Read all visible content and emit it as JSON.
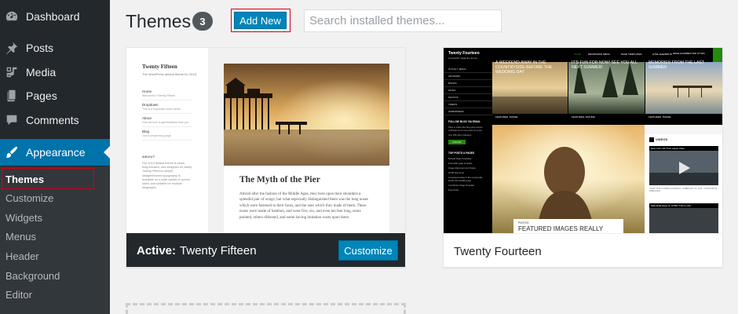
{
  "sidebar": {
    "items": [
      {
        "label": "Dashboard",
        "icon": "dashboard-icon"
      },
      {
        "label": "Posts",
        "icon": "pin-icon"
      },
      {
        "label": "Media",
        "icon": "media-icon"
      },
      {
        "label": "Pages",
        "icon": "pages-icon"
      },
      {
        "label": "Comments",
        "icon": "comment-icon"
      },
      {
        "label": "Appearance",
        "icon": "paintbrush-icon",
        "active": true
      }
    ],
    "submenu": [
      "Themes",
      "Customize",
      "Widgets",
      "Menus",
      "Header",
      "Background",
      "Editor"
    ],
    "current_submenu": "Themes"
  },
  "header": {
    "title": "Themes",
    "count": "3",
    "add_new_label": "Add New",
    "search_placeholder": "Search installed themes..."
  },
  "themes": [
    {
      "name": "Twenty Fifteen",
      "active": true,
      "active_label": "Active:",
      "customize_label": "Customize",
      "preview": {
        "site_title": "Twenty Fifteen",
        "site_desc": "The WordPress default theme for 2015.",
        "nav": [
          {
            "label": "Home",
            "desc": "Welcome to Twenty Fifteen"
          },
          {
            "label": "Dropdown",
            "desc": "This is a dropdown menu demo"
          },
          {
            "label": "About",
            "desc": "How we love to get feedback from you"
          },
          {
            "label": "Blog",
            "desc": "Just a simple blog page"
          }
        ],
        "about_heading": "ABOUT",
        "about_text": "Our 2015 default theme is clean, blog-focused, and designed for clarity. Twenty Fifteen's simple, straightforward typography is readable on a wide variety of screen sizes, and suitable for multiple languages.",
        "post_title": "The Myth of the Pier",
        "post_body": "Attired after the fashion of the Middle Ages, they bore upon their shoulders a splendid pair of wings; but what especially distinguished them was the long noses which were fastened to their faces, and the uses which they made of them. These noses were made of bamboo, and were five, six, and even ten feet long, some pointed, others ribboned, and some having imitation warts upon them."
      }
    },
    {
      "name": "Twenty Fourteen",
      "active": false,
      "preview": {
        "site_title": "Twenty Fourteen",
        "tagline": "A beautiful magazine theme",
        "menu": [
          "HOME",
          "DROPDOWN MENU",
          "PAGE TEMPLATES",
          "HTML ELEMENTS",
          "IMAGE ALIGNMENT AND STYLES"
        ],
        "left_menu": [
          "IS FOLLY MENU",
          "ARTWORK",
          "BOOKS",
          "MUSIC",
          "PHOTOS",
          "VIDEOS",
          "WORDPRESS"
        ],
        "follow_heading": "FOLLOW BLOG VIA EMAIL",
        "follow_text": "Click to follow this blog and receive notifications of new posts by email.",
        "join_text": "Join 456 other followers",
        "follow_button": "FOLLOW",
        "top_posts_heading": "TOP POSTS & PAGES",
        "top_posts": [
          "Default Page Templates",
          "Full-width page template",
          "Image Alignment and Styles",
          "HTML Elements",
          "A weekend away in the countryside before the wedding day",
          "Contributor Page Template",
          "Post Child"
        ],
        "featured": [
          {
            "cat": "FEATURED, TRAVEL",
            "title": "A WEEKEND AWAY IN THE COUNTRYSIDE BEFORE THE WEDDING DAY"
          },
          {
            "cat": "FEATURED, NATURE",
            "title": "IT'S FUN FOR NOW! SEE YOU ALL NEXT SUMMER!"
          },
          {
            "cat": "FEATURED, TRAVEL",
            "title": "MEMORIES FROM THE LAST SUMMER"
          }
        ],
        "photo_label_small": "PHOTOS",
        "photo_label_big": "FEATURED IMAGES REALLY",
        "videos_heading": "VIDEOS",
        "video1": "New York: HD Time Lapse video",
        "video1_meta": "VIDEO POST FORMAT EXAMPLE · FEBRUARY 13, 2013 · KONSTANTIN OBENLAND",
        "video2": "Matt Mullenweg on KTBN \"This Is Life\""
      }
    }
  ],
  "colors": {
    "sidebar_bg": "#23282d",
    "submenu_bg": "#32373c",
    "accent": "#0073aa",
    "button": "#0085ba",
    "highlight": "#d0021b"
  }
}
